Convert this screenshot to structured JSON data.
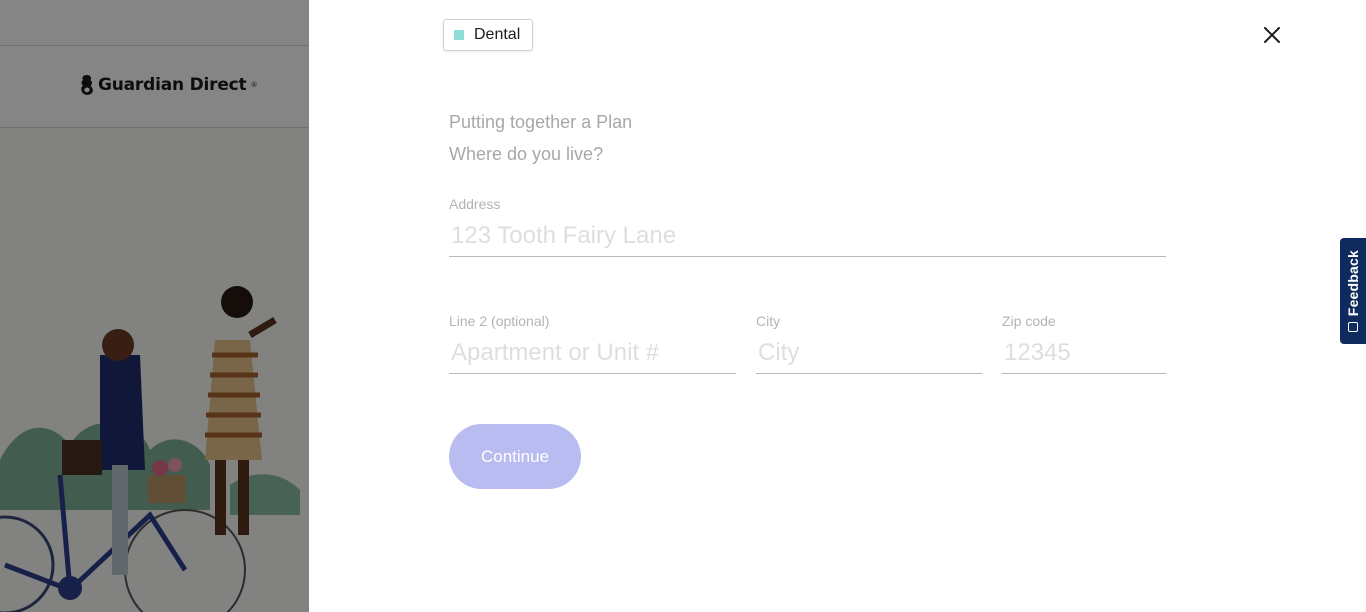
{
  "background": {
    "brand": "Guardian Direct",
    "brand_mark": "®"
  },
  "drawer": {
    "product_tag": "Dental",
    "close_icon": "close-icon",
    "step_title": "Putting together a Plan",
    "step_question": "Where do you live?",
    "fields": {
      "address": {
        "label": "Address",
        "placeholder": "123 Tooth Fairy Lane",
        "value": ""
      },
      "line2": {
        "label": "Line 2 (optional)",
        "placeholder": "Apartment or Unit #",
        "value": ""
      },
      "city": {
        "label": "City",
        "placeholder": "City",
        "value": ""
      },
      "zip": {
        "label": "Zip code",
        "placeholder": "12345",
        "value": ""
      }
    },
    "continue_label": "Continue"
  },
  "feedback": {
    "label": "Feedback",
    "icon": "feedback-icon"
  },
  "colors": {
    "accent_disabled": "#b9bcf0",
    "product_swatch": "#8fded8",
    "feedback_bg": "#0f2a5c"
  }
}
